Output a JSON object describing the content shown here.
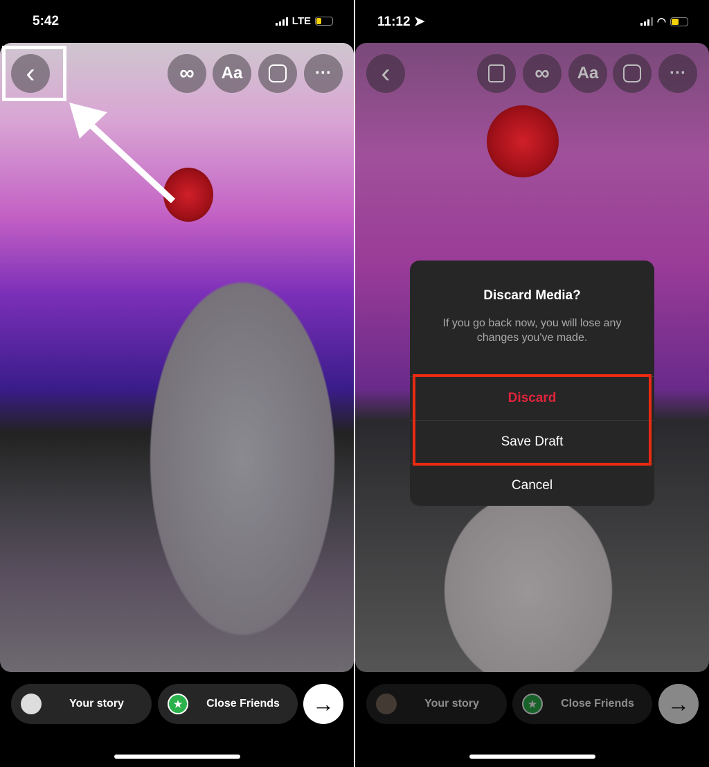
{
  "left": {
    "status": {
      "time": "5:42",
      "network": "LTE"
    },
    "toolbar": {
      "back_icon": "chevron-left",
      "buttons": [
        "infinity",
        "Aa",
        "sticker",
        "more"
      ]
    },
    "bottom": {
      "your_story": "Your story",
      "close_friends": "Close Friends"
    }
  },
  "right": {
    "status": {
      "time": "11:12",
      "location_icon": "location-arrow",
      "wifi": "wifi",
      "battery": "charging"
    },
    "toolbar": {
      "buttons": [
        "mention",
        "infinity",
        "Aa",
        "sticker",
        "more"
      ]
    },
    "dialog": {
      "title": "Discard Media?",
      "message": "If you go back now, you will lose any changes you've made.",
      "discard": "Discard",
      "save_draft": "Save Draft",
      "cancel": "Cancel"
    },
    "bottom": {
      "your_story": "Your story",
      "close_friends": "Close Friends"
    }
  },
  "labels": {
    "aa": "Aa",
    "infinity": "∞",
    "more": "···",
    "arrow": "→",
    "back": "‹"
  },
  "colors": {
    "discard": "#e0243c",
    "highlight_box": "#ea2a12",
    "close_friends": "#2bb24c"
  }
}
